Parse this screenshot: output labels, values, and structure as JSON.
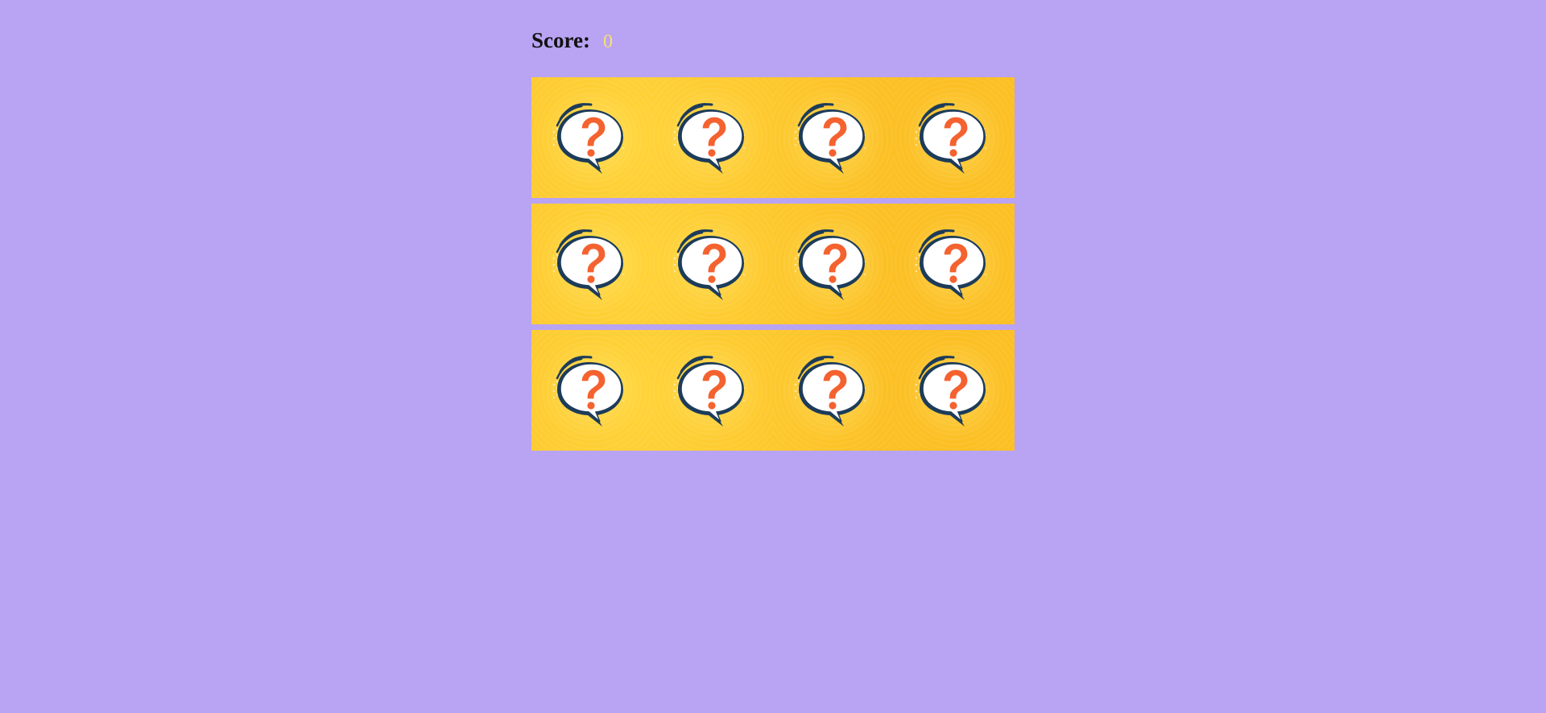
{
  "score": {
    "label": "Score:",
    "value": "0"
  },
  "board": {
    "rows": 3,
    "columns": 4,
    "card_icon": "question-bubble-icon",
    "colors": {
      "background": "#b9a3f3",
      "card_face": "#fcbf24",
      "question_mark": "#f4622f",
      "bubble_outline": "#1d3c5a",
      "score_value": "#f7e26b"
    }
  }
}
